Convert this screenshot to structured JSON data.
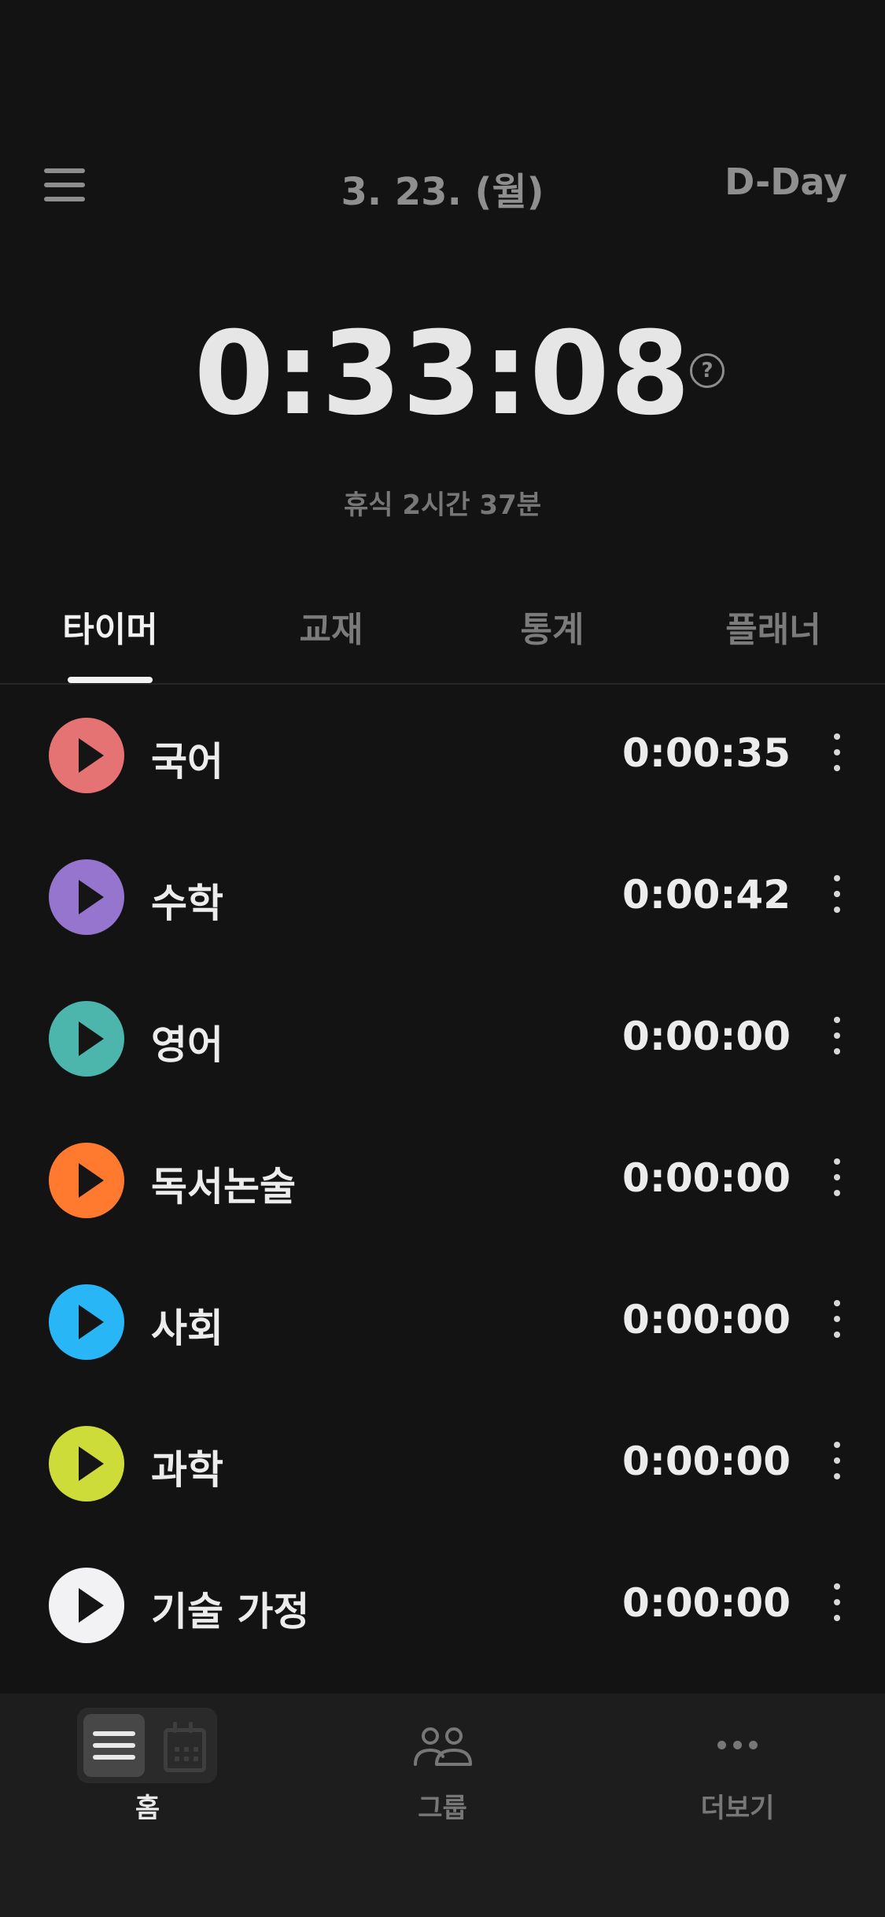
{
  "header": {
    "date": "3. 23. (월)",
    "dday_label": "D-Day",
    "menu_icon": "hamburger-menu-icon"
  },
  "total_time": "0:33:08",
  "help_icon": "question-circle-icon",
  "help_glyph": "?",
  "rest_text": "휴식 2시간 37분",
  "tabs": [
    {
      "label": "타이머",
      "active": true
    },
    {
      "label": "교재",
      "active": false
    },
    {
      "label": "통계",
      "active": false
    },
    {
      "label": "플래너",
      "active": false
    }
  ],
  "subjects": [
    {
      "name": "국어",
      "time": "0:00:35",
      "color": "#e57373"
    },
    {
      "name": "수학",
      "time": "0:00:42",
      "color": "#9575cd"
    },
    {
      "name": "영어",
      "time": "0:00:00",
      "color": "#4db6ac"
    },
    {
      "name": "독서논술",
      "time": "0:00:00",
      "color": "#ff7a2f"
    },
    {
      "name": "사회",
      "time": "0:00:00",
      "color": "#29b6f6"
    },
    {
      "name": "과학",
      "time": "0:00:00",
      "color": "#cddc39"
    },
    {
      "name": "기술 가정",
      "time": "0:00:00",
      "color": "#f2f2f4"
    }
  ],
  "bottom_nav": [
    {
      "label": "홈",
      "icon": "list-calendar-toggle-icon",
      "active": true
    },
    {
      "label": "그룹",
      "icon": "group-icon",
      "active": false
    },
    {
      "label": "더보기",
      "icon": "more-dots-icon",
      "active": false
    }
  ]
}
